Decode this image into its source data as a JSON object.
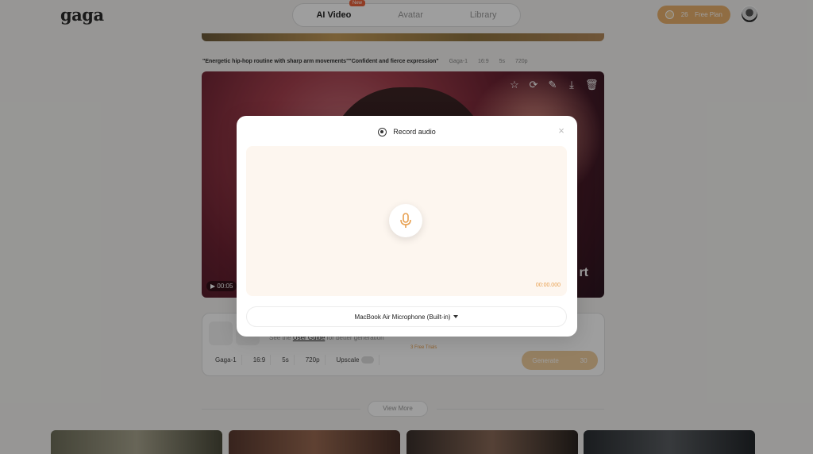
{
  "app": {
    "logo": "gaga"
  },
  "nav": {
    "tabs": [
      {
        "label": "AI Video",
        "active": true
      },
      {
        "label": "Avatar",
        "active": false
      },
      {
        "label": "Library",
        "active": false
      }
    ],
    "new_badge": "New"
  },
  "account": {
    "credits": "26",
    "plan": "Free Plan"
  },
  "generation": {
    "prompt": "\"Energetic hip-hop routine with sharp arm movements\"\"Confident and fierce expression\"",
    "model": "Gaga-1",
    "ratio": "16:9",
    "duration": "5s",
    "resolution": "720p",
    "timecode": "00:05",
    "overlay_text": "rt",
    "tool_icons": [
      "star-icon",
      "refresh-icon",
      "edit-icon",
      "download-icon",
      "trash-icon"
    ]
  },
  "composer": {
    "hint_prefix": "See the",
    "hint_link": "User Guide",
    "hint_suffix": "for better generation",
    "options": {
      "model": "Gaga-1",
      "ratio": "16:9",
      "duration": "5s",
      "resolution": "720p",
      "upscale": "Upscale"
    },
    "free_trials": "3 Free Trials",
    "generate_label": "Generate",
    "generate_cost": "30"
  },
  "view_more": "View More",
  "modal": {
    "title": "Record audio",
    "close": "×",
    "timer": "00:00.000",
    "device": "MacBook Air Microphone (Built-in)"
  },
  "colors": {
    "accent": "#e8a050",
    "record_bg": "#fdf6ef",
    "plan_pill": "#e9b06c",
    "new_badge": "#e8623a"
  }
}
